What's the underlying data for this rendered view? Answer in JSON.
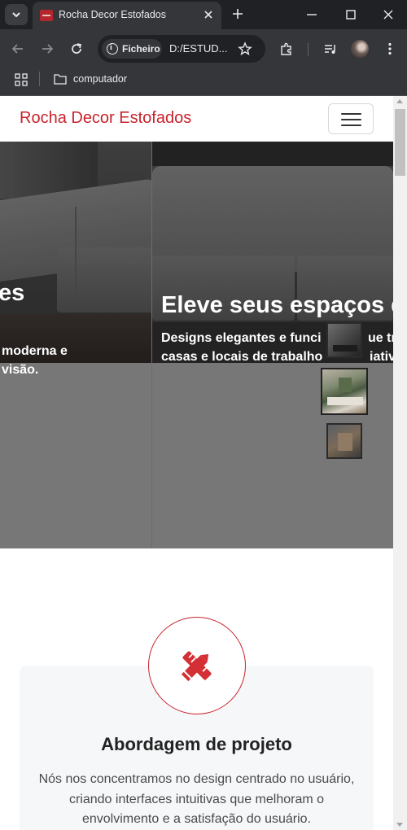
{
  "browser": {
    "tab_title": "Rocha Decor Estofados",
    "security_chip": "Ficheiro",
    "url": "D:/ESTUD...",
    "bookmark_folder": "computador"
  },
  "page": {
    "brand": "Rocha Decor Estofados",
    "hero": {
      "left_slide": {
        "title_fragment": "es",
        "subtitle_line1": "moderna e",
        "subtitle_line2": "visão."
      },
      "right_slide": {
        "title": "Eleve seus espaços d",
        "subtitle_line1": "Designs elegantes e funci",
        "subtitle_line1_end": "ue tr",
        "subtitle_line2": "casas e locais de trabalho",
        "subtitle_line2_end": "iativ"
      }
    },
    "feature": {
      "title": "Abordagem de projeto",
      "text": "Nós nos concentramos no design centrado no usuário, criando interfaces intuitivas que melhoram o envolvimento e a satisfação do usuário."
    }
  },
  "colors": {
    "brand": "#c8232c",
    "chrome_dark": "#202124",
    "chrome_toolbar": "#35363a"
  }
}
